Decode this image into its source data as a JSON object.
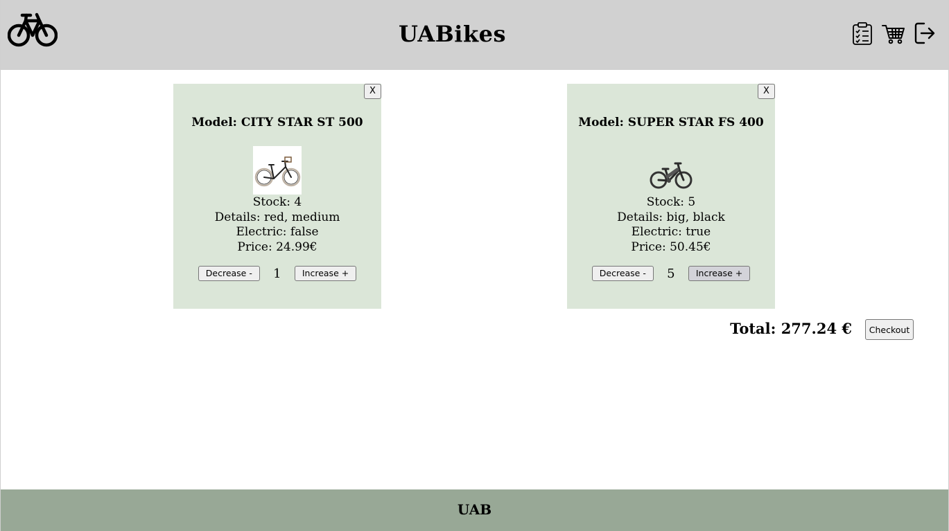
{
  "header": {
    "title": "UABikes",
    "logo_icon": "bicycle-icon",
    "actions": [
      {
        "name": "orders-icon",
        "label": "clipboard-list-icon"
      },
      {
        "name": "cart-icon",
        "label": "shopping-cart-icon"
      },
      {
        "name": "logout-icon",
        "label": "logout-arrow-icon"
      }
    ]
  },
  "cart": {
    "items": [
      {
        "remove_label": "X",
        "model": "Model: CITY STAR ST 500",
        "image_icon": "city-bike-image",
        "stock": "Stock: 4",
        "details": "Details: red, medium",
        "electric": "Electric: false",
        "price": "Price: 24.99€",
        "decrease_label": "Decrease -",
        "quantity": "1",
        "increase_label": "Increase +"
      },
      {
        "remove_label": "X",
        "model": "Model: SUPER STAR FS 400",
        "image_icon": "electric-bike-image",
        "stock": "Stock: 5",
        "details": "Details: big, black",
        "electric": "Electric: true",
        "price": "Price: 50.45€",
        "decrease_label": "Decrease -",
        "quantity": "5",
        "increase_label": "Increase +"
      }
    ],
    "total": "Total: 277.24 €",
    "checkout_label": "Checkout"
  },
  "footer": {
    "text": "UAB"
  },
  "colors": {
    "header_bg": "#d1d1d1",
    "card_bg": "#dbe6d8",
    "footer_bg": "#98a896"
  }
}
